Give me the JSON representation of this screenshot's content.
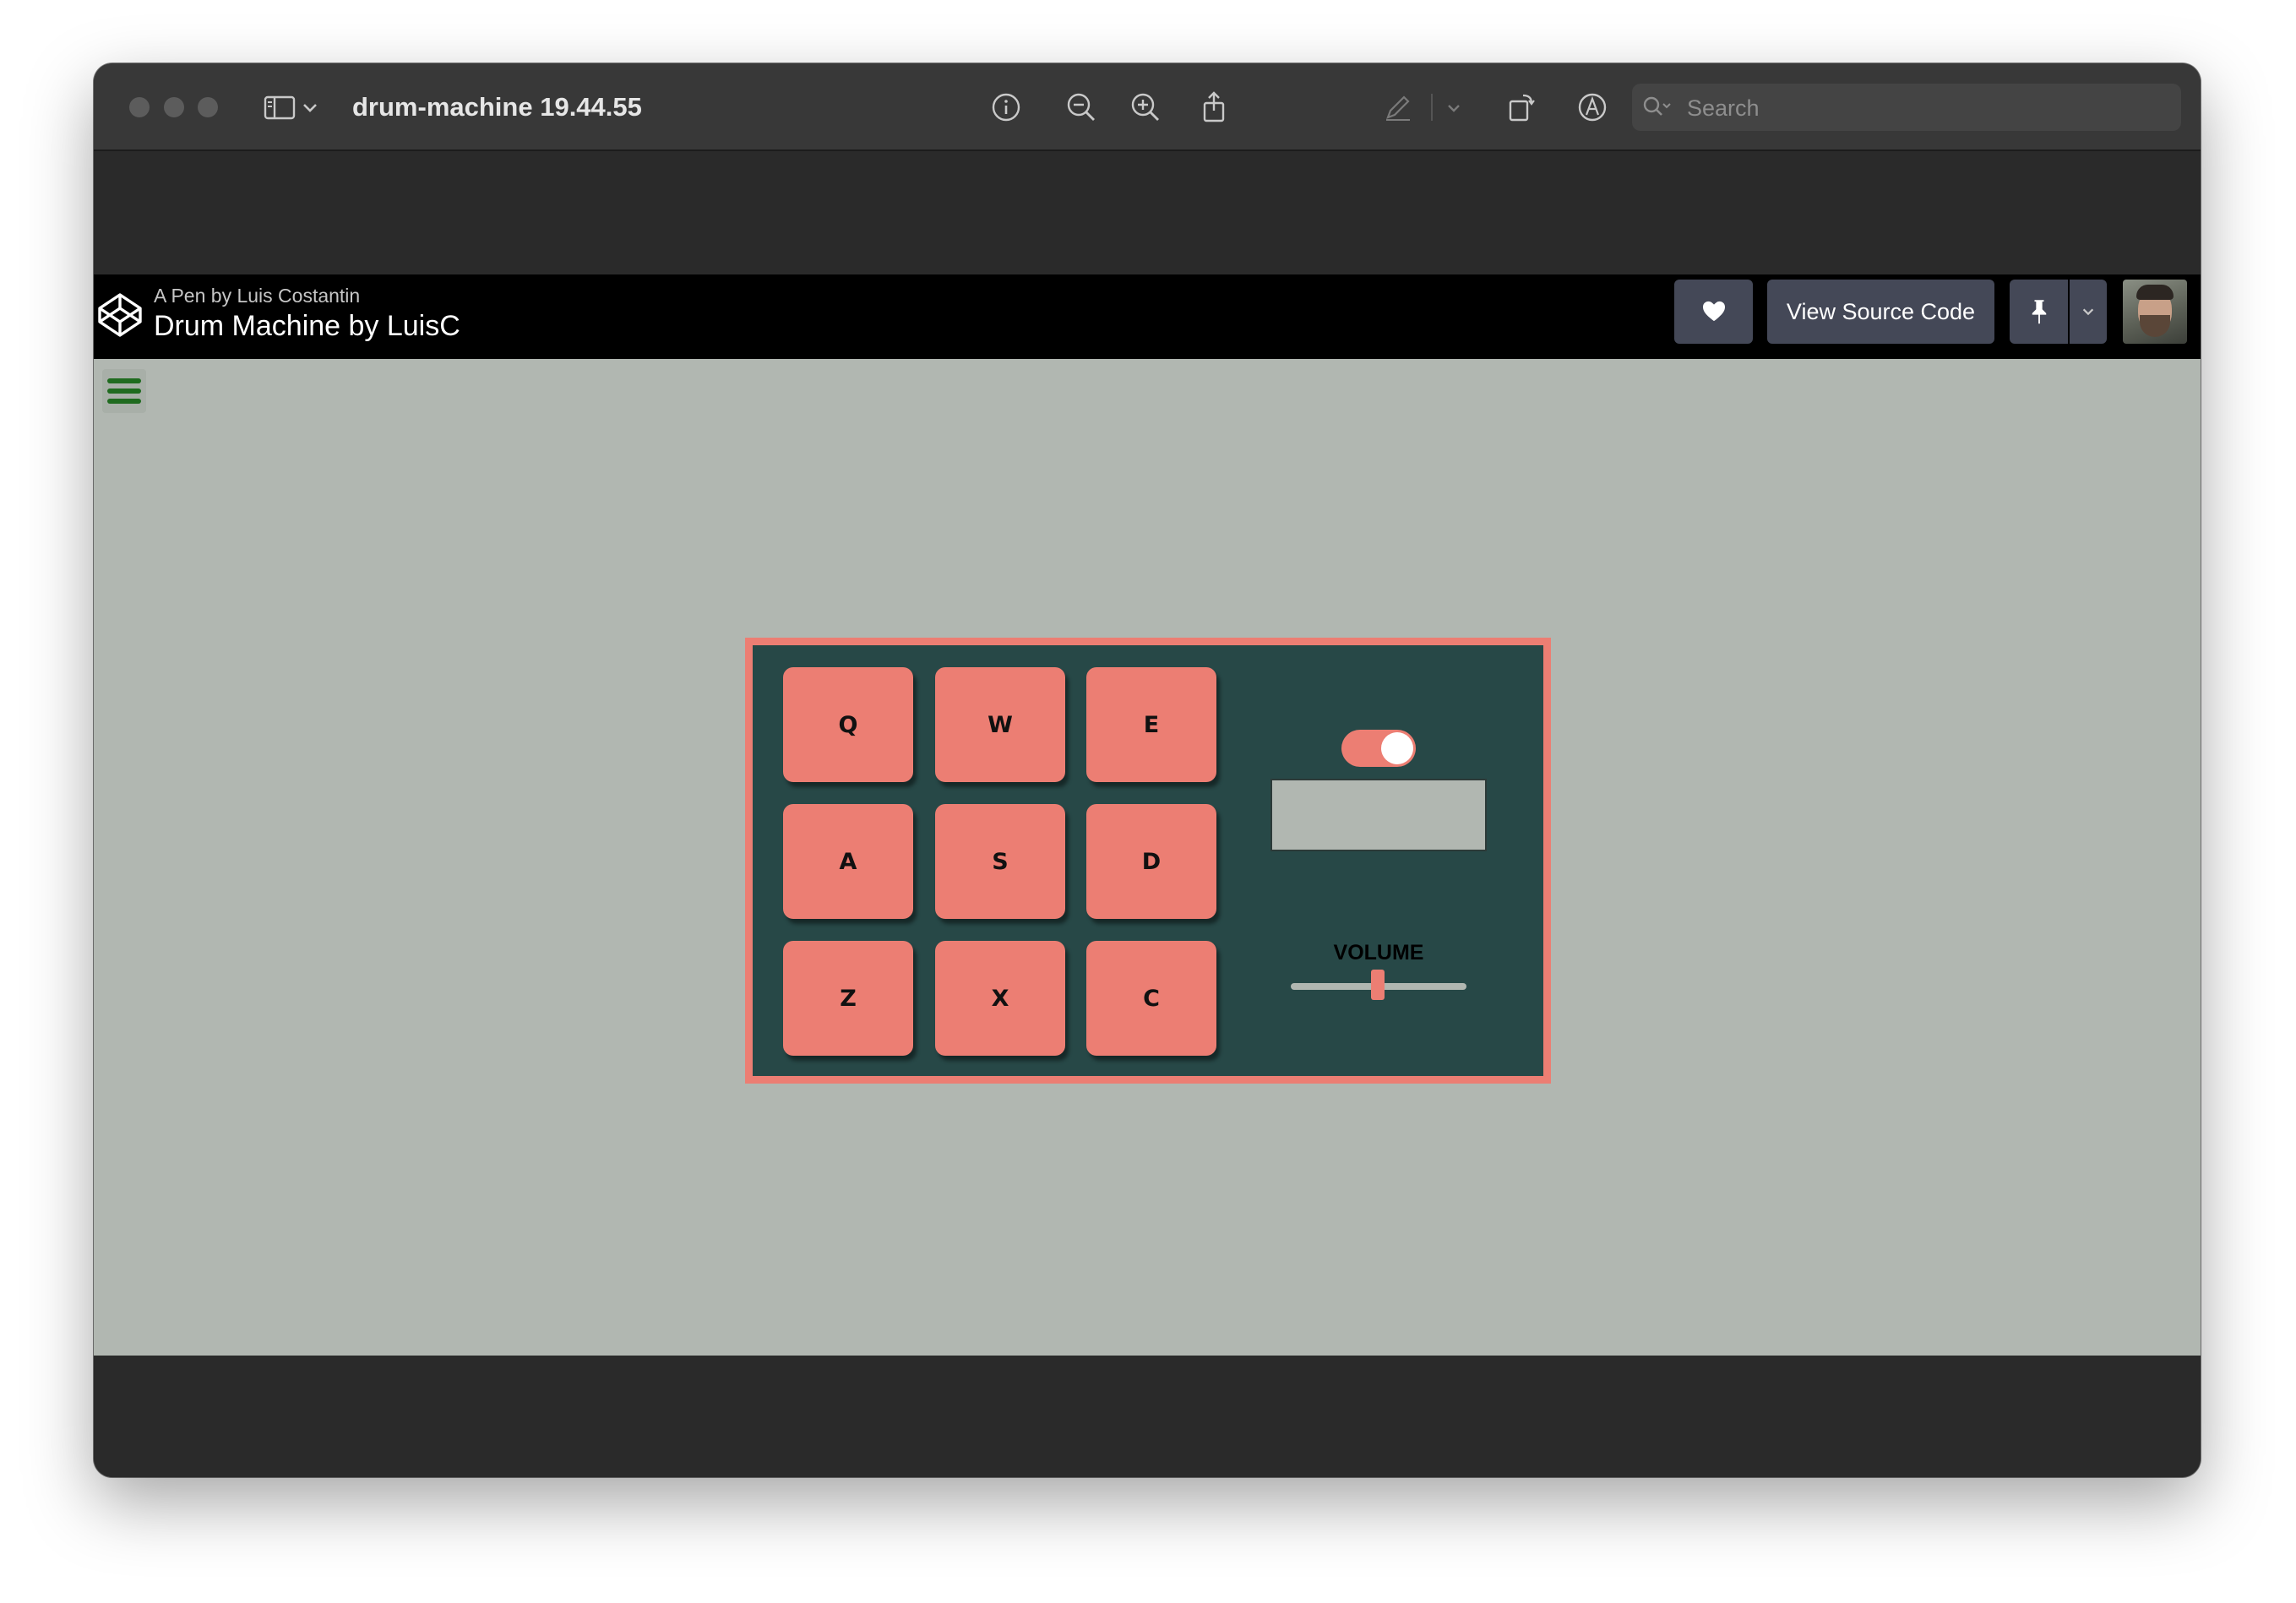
{
  "window": {
    "title": "drum-machine 19.44.55",
    "search_placeholder": "Search"
  },
  "codepen": {
    "byline": "A Pen by Luis Costantin",
    "title": "Drum Machine by LuisC",
    "view_source_label": "View Source Code"
  },
  "drum": {
    "pads": [
      "Q",
      "W",
      "E",
      "A",
      "S",
      "D",
      "Z",
      "X",
      "C"
    ],
    "power_on": true,
    "display_text": "",
    "volume_label": "VOLUME",
    "volume": 0.5
  },
  "colors": {
    "accent": "#ec7e73",
    "panel": "#274847",
    "background": "#b1b7b1",
    "menu_icon": "#1f6b1f"
  }
}
